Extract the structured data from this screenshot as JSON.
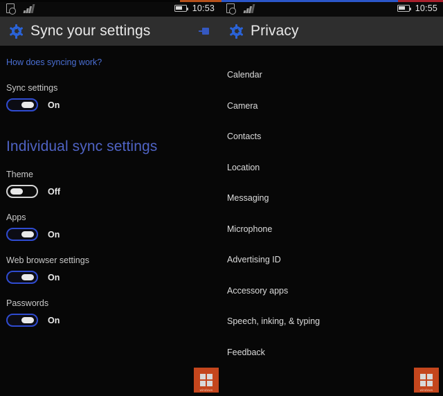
{
  "left_panel": {
    "status_bar": {
      "icons": [
        "document-sync-icon",
        "signal-icon"
      ],
      "battery_icon": "battery-icon",
      "clock": "10:53"
    },
    "header": {
      "gear_icon": "gear-icon",
      "title": "Sync your settings",
      "pin_icon": "pin-icon"
    },
    "help_link": "How does syncing work?",
    "master_setting": {
      "label": "Sync settings",
      "state": "On"
    },
    "section_heading": "Individual sync settings",
    "settings": [
      {
        "label": "Theme",
        "state": "Off"
      },
      {
        "label": "Apps",
        "state": "On"
      },
      {
        "label": "Web browser settings",
        "state": "On"
      },
      {
        "label": "Passwords",
        "state": "On"
      }
    ]
  },
  "right_panel": {
    "status_bar": {
      "icons": [
        "document-sync-icon",
        "signal-icon"
      ],
      "battery_icon": "battery-icon",
      "clock": "10:55"
    },
    "header": {
      "gear_icon": "gear-icon",
      "title": "Privacy"
    },
    "nav_items": [
      {
        "label": "Calendar"
      },
      {
        "label": "Camera"
      },
      {
        "label": "Contacts"
      },
      {
        "label": "Location"
      },
      {
        "label": "Messaging"
      },
      {
        "label": "Microphone"
      },
      {
        "label": "Advertising ID"
      },
      {
        "label": "Accessory apps"
      },
      {
        "label": "Speech, inking, & typing"
      },
      {
        "label": "Feedback"
      }
    ]
  },
  "watermarks": [
    {
      "text": "windows"
    },
    {
      "text": "windows"
    }
  ],
  "colors": {
    "accent_blue": "#2f4bd0",
    "link_blue": "#4a6fd4",
    "heading_blue": "#4f63c4",
    "appbar_gray": "#2e2e2e",
    "background": "#070707",
    "watermark_orange": "#c4461d"
  }
}
